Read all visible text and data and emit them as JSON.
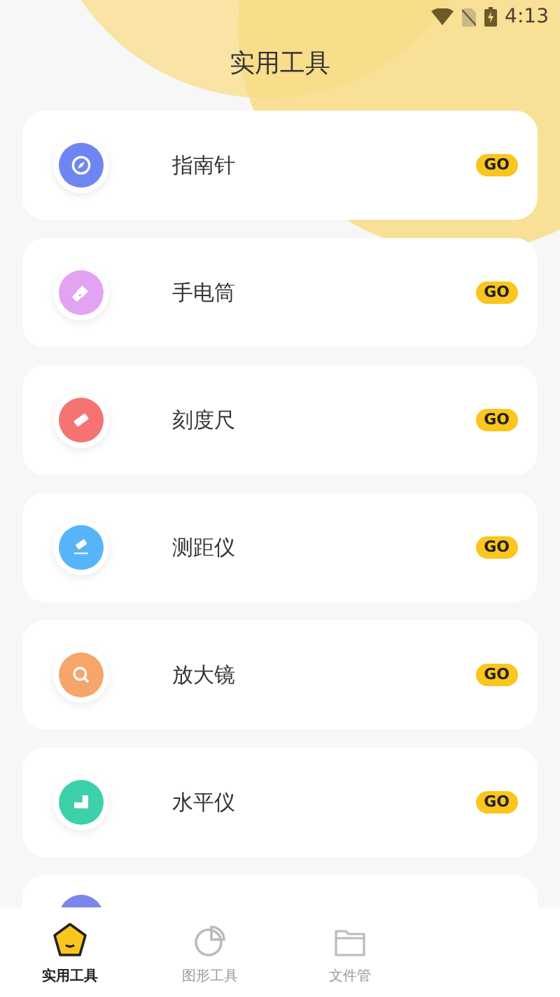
{
  "status_bar": {
    "time": "4:13"
  },
  "title": "实用工具",
  "tools": [
    {
      "name": "指南针",
      "kind": "compass",
      "color": "#6f86f2",
      "action": "GO"
    },
    {
      "name": "手电筒",
      "kind": "flashlight",
      "color": "#e3a3f3",
      "action": "GO"
    },
    {
      "name": "刻度尺",
      "kind": "ruler",
      "color": "#f57373",
      "action": "GO"
    },
    {
      "name": "测距仪",
      "kind": "rangefinder",
      "color": "#58b4f8",
      "action": "GO"
    },
    {
      "name": "放大镜",
      "kind": "magnifier",
      "color": "#f6a56b",
      "action": "GO"
    },
    {
      "name": "水平仪",
      "kind": "level",
      "color": "#3dd1ab",
      "action": "GO"
    }
  ],
  "more_card": {
    "color": "#7b86ec"
  },
  "tabs": [
    {
      "label": "实用工具",
      "kind": "home",
      "selected": true
    },
    {
      "label": "图形工具",
      "kind": "chart",
      "selected": false
    },
    {
      "label": "文件管",
      "kind": "folder",
      "selected": false
    }
  ]
}
